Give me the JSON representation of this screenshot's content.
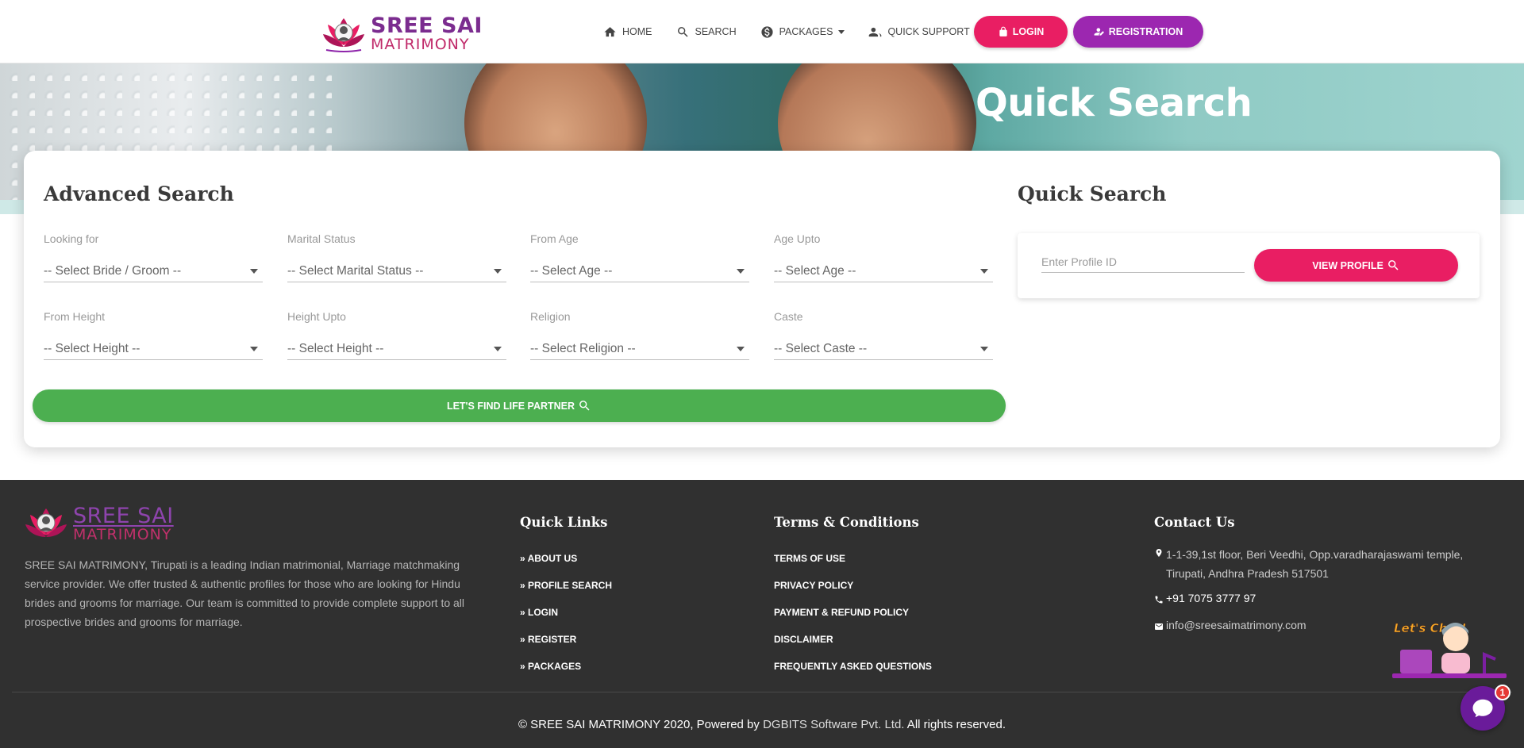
{
  "brand": {
    "line1": "SREE SAI",
    "line2": "MATRIMONY"
  },
  "nav": {
    "home": "HOME",
    "search": "SEARCH",
    "packages": "PACKAGES",
    "quick_support": "QUICK SUPPORT",
    "login": "LOGIN",
    "registration": "REGISTRATION"
  },
  "hero": {
    "title": "Quick Search"
  },
  "advanced_search": {
    "title": "Advanced Search",
    "fields": [
      {
        "label": "Looking for",
        "value": "-- Select Bride / Groom --"
      },
      {
        "label": "Marital Status",
        "value": "-- Select Marital Status --"
      },
      {
        "label": "From Age",
        "value": "-- Select Age --"
      },
      {
        "label": "Age Upto",
        "value": "-- Select Age --"
      },
      {
        "label": "From Height",
        "value": "-- Select Height --"
      },
      {
        "label": "Height Upto",
        "value": "-- Select Height --"
      },
      {
        "label": "Religion",
        "value": "-- Select Religion --"
      },
      {
        "label": "Caste",
        "value": "-- Select Caste --"
      }
    ],
    "button": "LET'S FIND LIFE PARTNER"
  },
  "quick_search": {
    "title": "Quick Search",
    "placeholder": "Enter Profile ID",
    "button": "VIEW PROFILE"
  },
  "footer": {
    "about": "SREE SAI MATRIMONY, Tirupati is a leading Indian matrimonial, Marriage matchmaking service provider. We offer trusted & authentic profiles for those who are looking for Hindu brides and grooms for marriage. Our team is committed to provide complete support to all prospective brides and grooms for marriage.",
    "quick_links": {
      "title": "Quick Links",
      "items": [
        "» ABOUT US",
        "» PROFILE SEARCH",
        "» LOGIN",
        "» REGISTER",
        "» PACKAGES"
      ]
    },
    "terms": {
      "title": "Terms & Conditions",
      "items": [
        "TERMS OF USE",
        "PRIVACY POLICY",
        "PAYMENT & REFUND POLICY",
        "DISCLAIMER",
        "FREQUENTLY ASKED QUESTIONS"
      ]
    },
    "contact": {
      "title": "Contact Us",
      "address": "1-1-39,1st floor, Beri Veedhi, Opp.varadharajaswami temple, Tirupati, Andhra Pradesh 517501",
      "phone": "+91 7075 3777 97",
      "email": "info@sreesaimatrimony.com"
    },
    "copyright_prefix": "© SREE SAI MATRIMONY 2020, Powered by ",
    "copyright_link": "DGBITS Software Pvt. Ltd.",
    "copyright_suffix": " All rights reserved."
  },
  "chat": {
    "illustration_text": "Let's Chat!",
    "badge_count": "1"
  },
  "colors": {
    "login": "#e91e63",
    "registration": "#9c27b0",
    "find_button": "#4caf50",
    "footer_bg": "#303030"
  }
}
